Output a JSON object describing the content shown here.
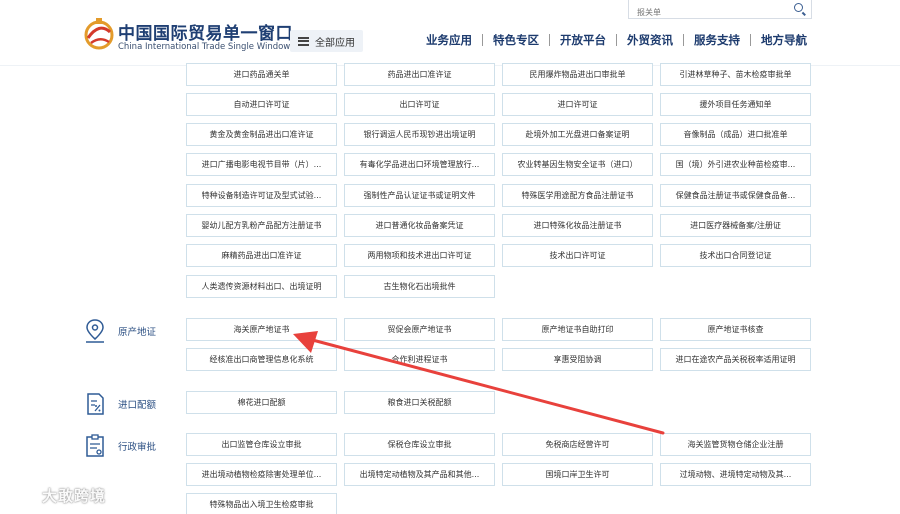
{
  "header": {
    "brand_cn": "中国国际贸易单一窗口",
    "brand_en": "China International Trade Single Window",
    "menu_label": "全部应用",
    "search_placeholder": "报关单",
    "nav": [
      "业务应用",
      "特色专区",
      "开放平台",
      "外贸资讯",
      "服务支持",
      "地方导航"
    ]
  },
  "license_rows": [
    [
      "进口药品通关单",
      "药品进出口准许证",
      "民用爆炸物品进出口审批单",
      "引进林草种子、苗木检疫审批单"
    ],
    [
      "自动进口许可证",
      "出口许可证",
      "进口许可证",
      "援外项目任务通知单"
    ],
    [
      "黄金及黄金制品进出口准许证",
      "银行调运人民币现钞进出境证明",
      "赴境外加工光盘进口备案证明",
      "音像制品（成品）进口批准单"
    ],
    [
      "进口广播电影电视节目带（片）...",
      "有毒化学品进出口环境管理放行...",
      "农业转基因生物安全证书（进口）",
      "国（境）外引进农业种苗检疫审..."
    ],
    [
      "特种设备制造许可证及型式试验...",
      "强制性产品认证证书或证明文件",
      "特殊医学用途配方食品注册证书",
      "保健食品注册证书或保健食品备..."
    ],
    [
      "婴幼儿配方乳粉产品配方注册证书",
      "进口普通化妆品备案凭证",
      "进口特殊化妆品注册证书",
      "进口医疗器械备案/注册证"
    ],
    [
      "麻精药品进出口准许证",
      "两用物项和技术进出口许可证",
      "技术出口许可证",
      "技术出口合同登记证"
    ],
    [
      "人类遗传资源材料出口、出境证明",
      "古生物化石出境批件"
    ]
  ],
  "sections": {
    "origin": {
      "label": "原产地证",
      "rows": [
        [
          "海关原产地证书",
          "贸促会原产地证书",
          "原产地证书自助打印",
          "原产地证书核查"
        ],
        [
          "经核准出口商管理信息化系统",
          "合作利进程证书",
          "享惠受阻协调",
          "进口在途农产品关税税率适用证明"
        ]
      ]
    },
    "quota": {
      "label": "进口配额",
      "rows": [
        [
          "棉花进口配额",
          "粮食进口关税配额"
        ]
      ]
    },
    "admin": {
      "label": "行政审批",
      "rows": [
        [
          "出口监管仓库设立审批",
          "保税仓库设立审批",
          "免税商店经营许可",
          "海关监管货物仓储企业注册"
        ],
        [
          "进出境动植物检疫除害处理单位...",
          "出境特定动植物及其产品和其他...",
          "国境口岸卫生许可",
          "过境动物、进境特定动物及其..."
        ],
        [
          "特殊物品出入境卫生检疫审批"
        ]
      ]
    }
  },
  "watermark": "大敢跨境",
  "colors": {
    "brand_blue": "#1f3f73",
    "cell_border": "#cfe0ea",
    "arrow_red": "#e8413c",
    "icon_blue": "#2f5b95"
  }
}
